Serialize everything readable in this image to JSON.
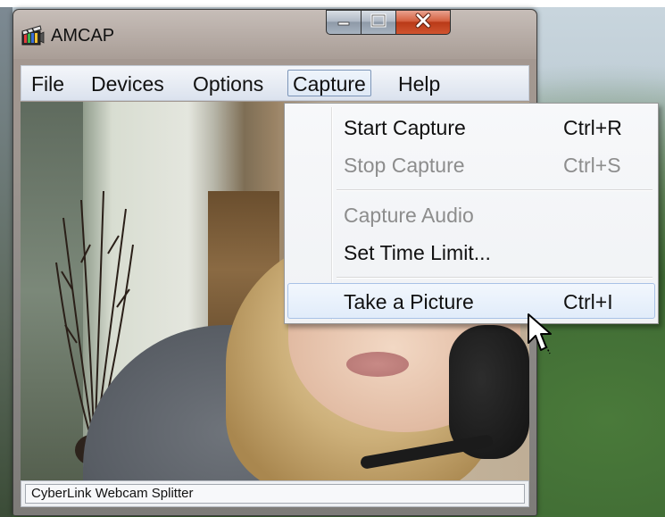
{
  "window": {
    "title": "AMCAP",
    "controls": {
      "minimize": "minimize",
      "maximize": "maximize",
      "close": "close"
    }
  },
  "menubar": {
    "items": [
      {
        "label": "File"
      },
      {
        "label": "Devices"
      },
      {
        "label": "Options"
      },
      {
        "label": "Capture"
      },
      {
        "label": "Help"
      }
    ],
    "active": "Capture"
  },
  "capture_menu": {
    "items": [
      {
        "label": "Start Capture",
        "shortcut": "Ctrl+R",
        "enabled": true
      },
      {
        "label": "Stop Capture",
        "shortcut": "Ctrl+S",
        "enabled": false
      },
      {
        "label": "Capture Audio",
        "shortcut": "",
        "enabled": false
      },
      {
        "label": "Set Time Limit...",
        "shortcut": "",
        "enabled": true
      },
      {
        "label": "Take a Picture",
        "shortcut": "Ctrl+I",
        "enabled": true,
        "highlighted": true
      }
    ]
  },
  "statusbar": {
    "text": "CyberLink Webcam Splitter"
  },
  "colors": {
    "close_button": "#c9482a",
    "menu_highlight_border": "#a9c2e6",
    "disabled_text": "#8d8d8d"
  },
  "icons": {
    "app": "film-clapper-icon",
    "cursor": "arrow-cursor-icon"
  }
}
